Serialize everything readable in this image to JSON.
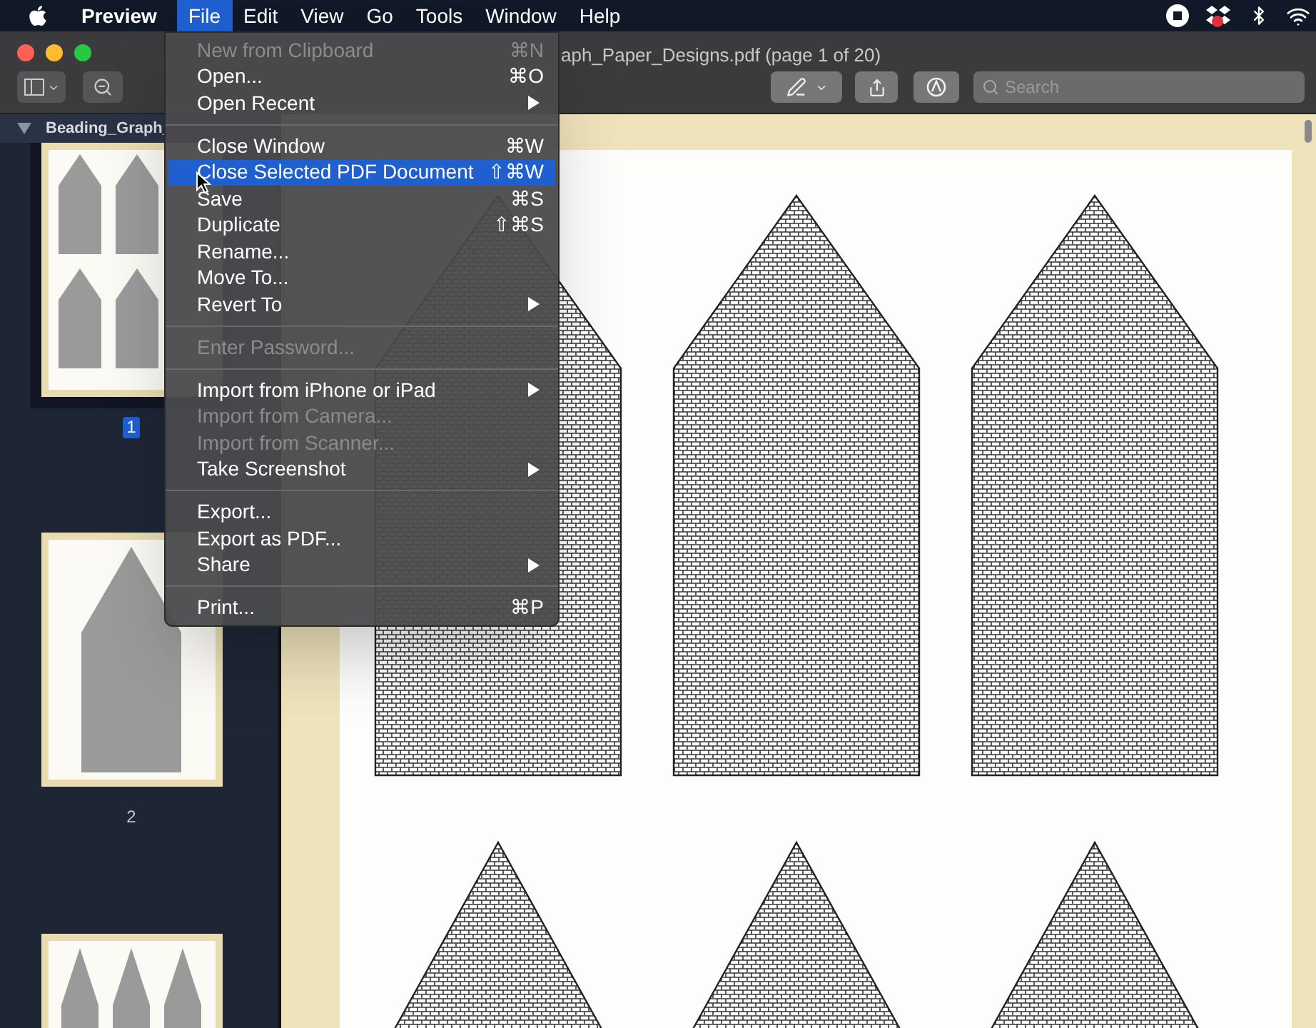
{
  "menu_bar": {
    "app_name": "Preview",
    "menus": [
      {
        "label": "File",
        "selected": true
      },
      {
        "label": "Edit",
        "selected": false
      },
      {
        "label": "View",
        "selected": false
      },
      {
        "label": "Go",
        "selected": false
      },
      {
        "label": "Tools",
        "selected": false
      },
      {
        "label": "Window",
        "selected": false
      },
      {
        "label": "Help",
        "selected": false
      }
    ]
  },
  "window": {
    "title": "aph_Paper_Designs.pdf (page 1 of 20)",
    "search": {
      "placeholder": "Search"
    }
  },
  "sidebar": {
    "header": "Beading_Graph_",
    "pages": [
      {
        "label": "1",
        "selected": true
      },
      {
        "label": "2",
        "selected": false
      }
    ]
  },
  "file_menu": [
    {
      "kind": "item",
      "label": "New from Clipboard",
      "shortcut": "⌘N",
      "submenu": false,
      "disabled": true,
      "selected": false
    },
    {
      "kind": "item",
      "label": "Open...",
      "shortcut": "⌘O",
      "submenu": false,
      "disabled": false,
      "selected": false
    },
    {
      "kind": "item",
      "label": "Open Recent",
      "submenu": true,
      "disabled": false,
      "selected": false
    },
    {
      "kind": "separator"
    },
    {
      "kind": "item",
      "label": "Close Window",
      "shortcut": "⌘W",
      "submenu": false,
      "disabled": false,
      "selected": false
    },
    {
      "kind": "item",
      "label": "Close Selected PDF Document",
      "shortcut": "⇧⌘W",
      "submenu": false,
      "disabled": false,
      "selected": true
    },
    {
      "kind": "item",
      "label": "Save",
      "shortcut": "⌘S",
      "submenu": false,
      "disabled": false,
      "selected": false
    },
    {
      "kind": "item",
      "label": "Duplicate",
      "shortcut": "⇧⌘S",
      "submenu": false,
      "disabled": false,
      "selected": false
    },
    {
      "kind": "item",
      "label": "Rename...",
      "submenu": false,
      "disabled": false,
      "selected": false
    },
    {
      "kind": "item",
      "label": "Move To...",
      "submenu": false,
      "disabled": false,
      "selected": false
    },
    {
      "kind": "item",
      "label": "Revert To",
      "submenu": true,
      "disabled": false,
      "selected": false
    },
    {
      "kind": "separator"
    },
    {
      "kind": "item",
      "label": "Enter Password...",
      "submenu": false,
      "disabled": true,
      "selected": false
    },
    {
      "kind": "separator"
    },
    {
      "kind": "item",
      "label": "Import from iPhone or iPad",
      "submenu": true,
      "disabled": false,
      "selected": false
    },
    {
      "kind": "item",
      "label": "Import from Camera...",
      "submenu": false,
      "disabled": true,
      "selected": false
    },
    {
      "kind": "item",
      "label": "Import from Scanner...",
      "submenu": false,
      "disabled": true,
      "selected": false
    },
    {
      "kind": "item",
      "label": "Take Screenshot",
      "submenu": true,
      "disabled": false,
      "selected": false
    },
    {
      "kind": "separator"
    },
    {
      "kind": "item",
      "label": "Export...",
      "submenu": false,
      "disabled": false,
      "selected": false
    },
    {
      "kind": "item",
      "label": "Export as PDF...",
      "submenu": false,
      "disabled": false,
      "selected": false
    },
    {
      "kind": "item",
      "label": "Share",
      "submenu": true,
      "disabled": false,
      "selected": false
    },
    {
      "kind": "separator"
    },
    {
      "kind": "item",
      "label": "Print...",
      "shortcut": "⌘P",
      "submenu": false,
      "disabled": false,
      "selected": false
    }
  ]
}
